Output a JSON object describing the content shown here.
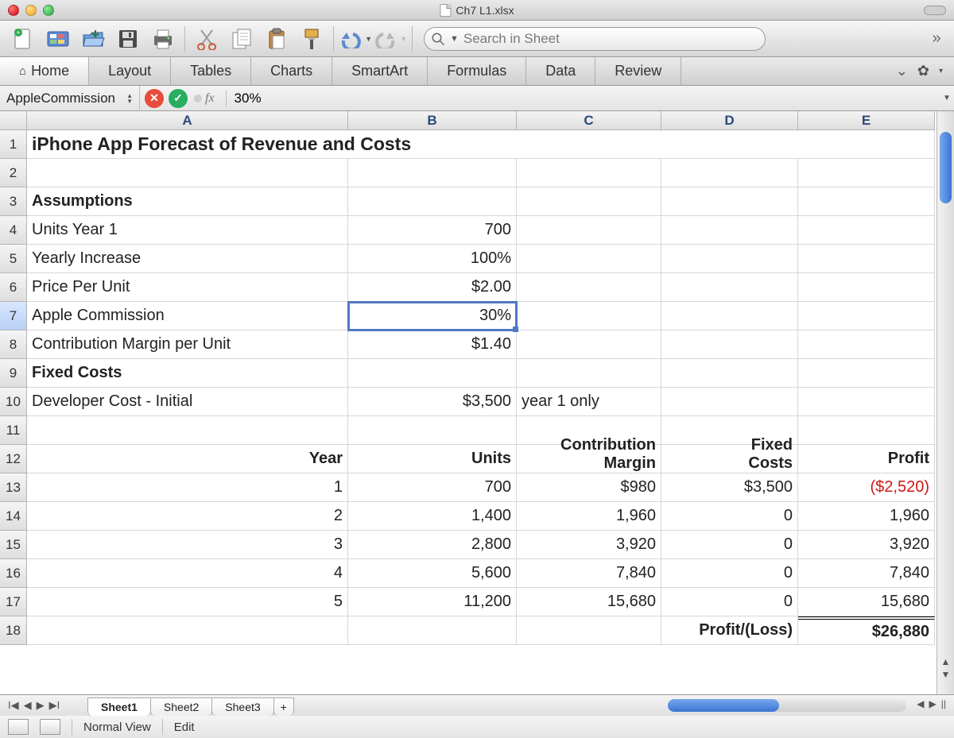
{
  "titlebar": {
    "filename": "Ch7 L1.xlsx"
  },
  "toolbar": {
    "search_placeholder": "Search in Sheet",
    "icons": [
      "new-doc",
      "gallery",
      "open",
      "save",
      "print",
      "cut",
      "copy",
      "paste",
      "format-painter",
      "undo",
      "redo"
    ]
  },
  "ribbon": {
    "tabs": [
      "Home",
      "Layout",
      "Tables",
      "Charts",
      "SmartArt",
      "Formulas",
      "Data",
      "Review"
    ],
    "active": 0
  },
  "formula_bar": {
    "name_box": "AppleCommission",
    "fx_label": "fx",
    "value": "30%"
  },
  "columns": [
    "A",
    "B",
    "C",
    "D",
    "E"
  ],
  "rows": [
    "1",
    "2",
    "3",
    "4",
    "5",
    "6",
    "7",
    "8",
    "9",
    "10",
    "11",
    "12",
    "13",
    "14",
    "15",
    "16",
    "17",
    "18"
  ],
  "selected_row": "7",
  "sheet": {
    "title": "iPhone App Forecast of Revenue and Costs",
    "assumptions_label": "Assumptions",
    "a4": "Units Year 1",
    "b4": "700",
    "a5": "Yearly Increase",
    "b5": "100%",
    "a6": "Price Per Unit",
    "b6": "$2.00",
    "a7": "Apple Commission",
    "b7": "30%",
    "a8": "Contribution Margin per Unit",
    "b8": "$1.40",
    "fixed_label": "Fixed  Costs",
    "a10": "Developer Cost - Initial",
    "b10": "$3,500",
    "c10": "year 1 only",
    "hdr": {
      "year": "Year",
      "units": "Units",
      "cm1": "Contribution",
      "cm2": "Margin",
      "fx1": "Fixed",
      "fx2": "Costs",
      "profit": "Profit"
    },
    "r13": {
      "y": "1",
      "u": "700",
      "cm": "$980",
      "fx": "$3,500",
      "p": "($2,520)"
    },
    "r14": {
      "y": "2",
      "u": "1,400",
      "cm": "1,960",
      "fx": "0",
      "p": "1,960"
    },
    "r15": {
      "y": "3",
      "u": "2,800",
      "cm": "3,920",
      "fx": "0",
      "p": "3,920"
    },
    "r16": {
      "y": "4",
      "u": "5,600",
      "cm": "7,840",
      "fx": "0",
      "p": "7,840"
    },
    "r17": {
      "y": "5",
      "u": "11,200",
      "cm": "15,680",
      "fx": "0",
      "p": "15,680"
    },
    "r18": {
      "label": "Profit/(Loss)",
      "total": "$26,880"
    }
  },
  "tabs": {
    "sheets": [
      "Sheet1",
      "Sheet2",
      "Sheet3"
    ],
    "active": 0,
    "plus": "+"
  },
  "status": {
    "view": "Normal View",
    "mode": "Edit"
  },
  "chart_data": {
    "type": "table",
    "title": "iPhone App Forecast of Revenue and Costs",
    "assumptions": {
      "units_year_1": 700,
      "yearly_increase_pct": 100,
      "price_per_unit_usd": 2.0,
      "apple_commission_pct": 30,
      "contribution_margin_per_unit_usd": 1.4,
      "developer_cost_initial_usd": 3500,
      "developer_cost_note": "year 1 only"
    },
    "columns": [
      "Year",
      "Units",
      "Contribution Margin",
      "Fixed Costs",
      "Profit"
    ],
    "rows": [
      {
        "Year": 1,
        "Units": 700,
        "Contribution Margin": 980,
        "Fixed Costs": 3500,
        "Profit": -2520
      },
      {
        "Year": 2,
        "Units": 1400,
        "Contribution Margin": 1960,
        "Fixed Costs": 0,
        "Profit": 1960
      },
      {
        "Year": 3,
        "Units": 2800,
        "Contribution Margin": 3920,
        "Fixed Costs": 0,
        "Profit": 3920
      },
      {
        "Year": 4,
        "Units": 5600,
        "Contribution Margin": 7840,
        "Fixed Costs": 0,
        "Profit": 7840
      },
      {
        "Year": 5,
        "Units": 11200,
        "Contribution Margin": 15680,
        "Fixed Costs": 0,
        "Profit": 15680
      }
    ],
    "summary": {
      "label": "Profit/(Loss)",
      "total": 26880
    }
  }
}
